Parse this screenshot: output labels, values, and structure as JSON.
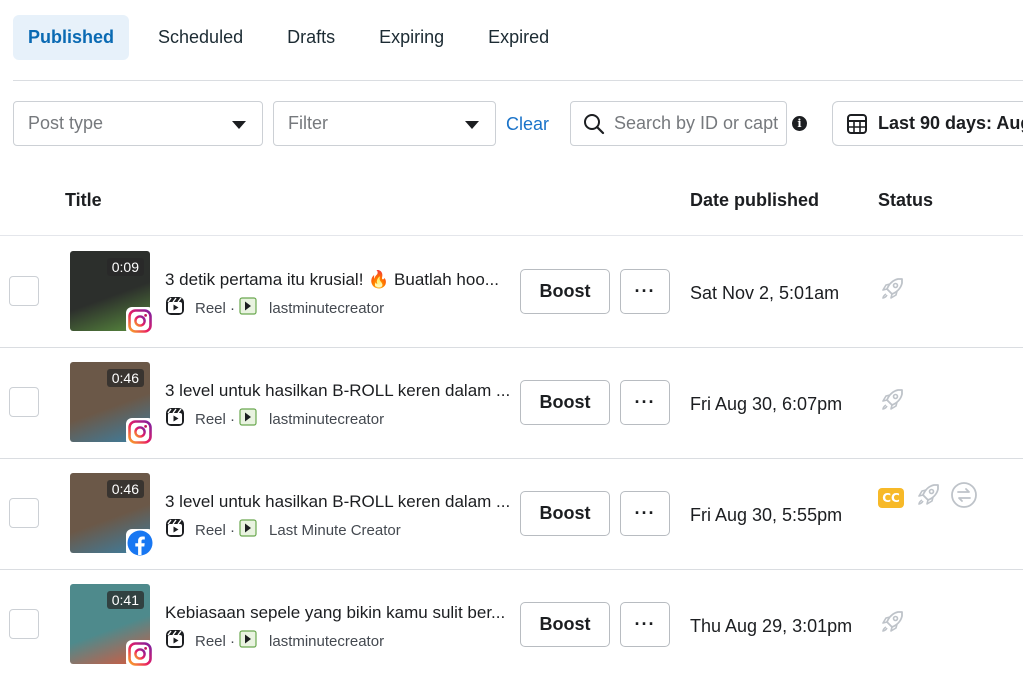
{
  "tabs": [
    {
      "label": "Published",
      "active": true
    },
    {
      "label": "Scheduled",
      "active": false
    },
    {
      "label": "Drafts",
      "active": false
    },
    {
      "label": "Expiring",
      "active": false
    },
    {
      "label": "Expired",
      "active": false
    }
  ],
  "filters": {
    "post_type_placeholder": "Post type",
    "filter_placeholder": "Filter",
    "clear_label": "Clear",
    "search_placeholder": "Search by ID or capt",
    "date_range_label": "Last 90 days: Aug"
  },
  "table": {
    "columns": {
      "title": "Title",
      "date": "Date published",
      "status": "Status"
    },
    "rows": [
      {
        "duration": "0:09",
        "title": "3 detik pertama itu krusial! 🔥 Buatlah hoo...",
        "type": "Reel ·",
        "account": "lastminutecreator",
        "platform": "instagram",
        "boost_label": "Boost",
        "more_label": "···",
        "date": "Sat Nov 2, 5:01am",
        "status_icons": [
          "rocket-icon"
        ],
        "thumb_color": "#2c2f2c",
        "thumb_accent": "#5a8f3e"
      },
      {
        "duration": "0:46",
        "title": "3 level untuk hasilkan B-ROLL keren dalam ...",
        "type": "Reel ·",
        "account": "lastminutecreator",
        "platform": "instagram",
        "boost_label": "Boost",
        "more_label": "···",
        "date": "Fri Aug 30, 6:07pm",
        "status_icons": [
          "rocket-icon"
        ],
        "thumb_color": "#6b5848",
        "thumb_accent": "#3b7fa3"
      },
      {
        "duration": "0:46",
        "title": "3 level untuk hasilkan B-ROLL keren dalam ...",
        "type": "Reel ·",
        "account": "Last Minute Creator",
        "platform": "facebook",
        "boost_label": "Boost",
        "more_label": "···",
        "date": "Fri Aug 30, 5:55pm",
        "status_icons": [
          "cc-icon",
          "rocket-icon",
          "crosspost-icon"
        ],
        "cc_label": "CC",
        "thumb_color": "#6b5848",
        "thumb_accent": "#3b7fa3"
      },
      {
        "duration": "0:41",
        "title": "Kebiasaan sepele yang bikin kamu sulit ber...",
        "type": "Reel ·",
        "account": "lastminutecreator",
        "platform": "instagram",
        "boost_label": "Boost",
        "more_label": "···",
        "date": "Thu Aug 29, 3:01pm",
        "status_icons": [
          "rocket-icon"
        ],
        "thumb_color": "#4e8a8c",
        "thumb_accent": "#d9583c"
      }
    ]
  },
  "colors": {
    "active_tab_bg": "#e7f1fa",
    "active_tab_text": "#0a6ab3",
    "link": "#1a73c9",
    "cc_badge": "#f7b928",
    "facebook_blue": "#1877f2"
  }
}
